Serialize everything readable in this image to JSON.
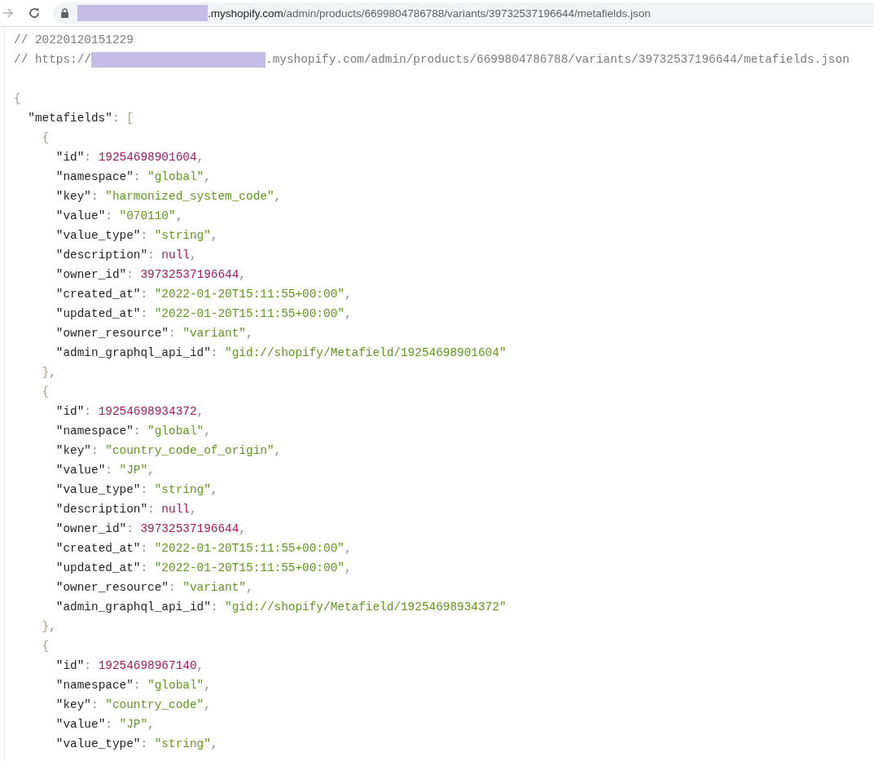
{
  "address_bar": {
    "url_host": ".myshopify.com",
    "url_path": "/admin/products/6699804786788/variants/39732537196644/metafields.json"
  },
  "comments": {
    "timestamp": "// 20220120151229",
    "url_prefix": "// https://",
    "url_suffix": ".myshopify.com/admin/products/6699804786788/variants/39732537196644/metafields.json"
  },
  "punctuation": {
    "open_object": "{",
    "close_object": "}",
    "open_array": "[",
    "colon": ": ",
    "comma": ","
  },
  "document": {
    "key": "\"metafields\"",
    "entries": [
      {
        "closed": true,
        "fields": [
          {
            "key": "\"id\"",
            "value": "19254698901604",
            "kind": "number"
          },
          {
            "key": "\"namespace\"",
            "value": "\"global\"",
            "kind": "string"
          },
          {
            "key": "\"key\"",
            "value": "\"harmonized_system_code\"",
            "kind": "string"
          },
          {
            "key": "\"value\"",
            "value": "\"070110\"",
            "kind": "string"
          },
          {
            "key": "\"value_type\"",
            "value": "\"string\"",
            "kind": "string"
          },
          {
            "key": "\"description\"",
            "value": "null",
            "kind": "null"
          },
          {
            "key": "\"owner_id\"",
            "value": "39732537196644",
            "kind": "number"
          },
          {
            "key": "\"created_at\"",
            "value": "\"2022-01-20T15:11:55+00:00\"",
            "kind": "string"
          },
          {
            "key": "\"updated_at\"",
            "value": "\"2022-01-20T15:11:55+00:00\"",
            "kind": "string"
          },
          {
            "key": "\"owner_resource\"",
            "value": "\"variant\"",
            "kind": "string"
          },
          {
            "key": "\"admin_graphql_api_id\"",
            "value": "\"gid://shopify/Metafield/19254698901604\"",
            "kind": "string"
          }
        ]
      },
      {
        "closed": true,
        "fields": [
          {
            "key": "\"id\"",
            "value": "19254698934372",
            "kind": "number"
          },
          {
            "key": "\"namespace\"",
            "value": "\"global\"",
            "kind": "string"
          },
          {
            "key": "\"key\"",
            "value": "\"country_code_of_origin\"",
            "kind": "string"
          },
          {
            "key": "\"value\"",
            "value": "\"JP\"",
            "kind": "string"
          },
          {
            "key": "\"value_type\"",
            "value": "\"string\"",
            "kind": "string"
          },
          {
            "key": "\"description\"",
            "value": "null",
            "kind": "null"
          },
          {
            "key": "\"owner_id\"",
            "value": "39732537196644",
            "kind": "number"
          },
          {
            "key": "\"created_at\"",
            "value": "\"2022-01-20T15:11:55+00:00\"",
            "kind": "string"
          },
          {
            "key": "\"updated_at\"",
            "value": "\"2022-01-20T15:11:55+00:00\"",
            "kind": "string"
          },
          {
            "key": "\"owner_resource\"",
            "value": "\"variant\"",
            "kind": "string"
          },
          {
            "key": "\"admin_graphql_api_id\"",
            "value": "\"gid://shopify/Metafield/19254698934372\"",
            "kind": "string"
          }
        ]
      },
      {
        "closed": false,
        "fields": [
          {
            "key": "\"id\"",
            "value": "19254698967140",
            "kind": "number"
          },
          {
            "key": "\"namespace\"",
            "value": "\"global\"",
            "kind": "string"
          },
          {
            "key": "\"key\"",
            "value": "\"country_code\"",
            "kind": "string"
          },
          {
            "key": "\"value\"",
            "value": "\"JP\"",
            "kind": "string"
          },
          {
            "key": "\"value_type\"",
            "value": "\"string\"",
            "kind": "string"
          }
        ]
      }
    ]
  }
}
